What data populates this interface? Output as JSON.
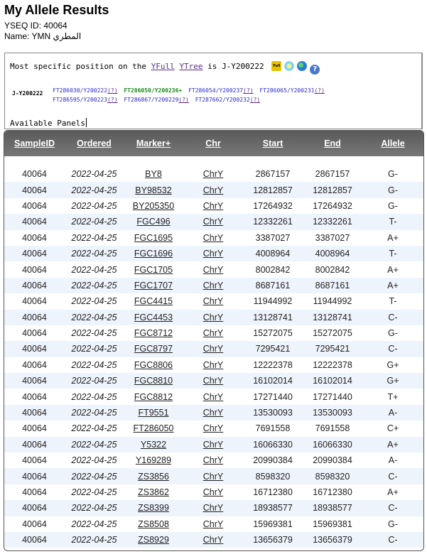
{
  "header": {
    "title": "My Allele Results",
    "yseq_label": "YSEQ ID: 40064",
    "name_label": "Name: YMN المطري"
  },
  "haplogroup": {
    "prefix": "Most specific position on the",
    "yfull_link": "YFull",
    "ytree_link": "YTree",
    "is_text": "is",
    "result": "J-Y200222",
    "full_icon_text": "Full",
    "help_icon_text": "?",
    "label": "J-Y200222",
    "equivalents_line1": [
      {
        "name": "FT286030/Y200222",
        "q": "(?)",
        "highlight": false
      },
      {
        "name": "FT286050/Y200236+",
        "q": "",
        "highlight": true
      },
      {
        "name": "FT286054/Y200237",
        "q": "(?)",
        "highlight": false
      },
      {
        "name": "FT286065/Y200231",
        "q": "(?)",
        "highlight": false
      }
    ],
    "equivalents_line2": [
      {
        "name": "FT286595/Y200223",
        "q": "(?)",
        "highlight": false
      },
      {
        "name": "FT286867/Y200229",
        "q": "(?)",
        "highlight": false
      },
      {
        "name": "FT287662/Y200232",
        "q": "(?)",
        "highlight": false
      }
    ],
    "available_panels": "Available Panels"
  },
  "table": {
    "headers": [
      "SampleID",
      "Ordered",
      "Marker+",
      "Chr",
      "Start",
      "End",
      "Allele"
    ],
    "rows": [
      [
        "40064",
        "2022-04-25",
        "BY8",
        "ChrY",
        "2867157",
        "2867157",
        "G-"
      ],
      [
        "40064",
        "2022-04-25",
        "BY98532",
        "ChrY",
        "12812857",
        "12812857",
        "G-"
      ],
      [
        "40064",
        "2022-04-25",
        "BY205350",
        "ChrY",
        "17264932",
        "17264932",
        "G-"
      ],
      [
        "40064",
        "2022-04-25",
        "FGC496",
        "ChrY",
        "12332261",
        "12332261",
        "T-"
      ],
      [
        "40064",
        "2022-04-25",
        "FGC1695",
        "ChrY",
        "3387027",
        "3387027",
        "A+"
      ],
      [
        "40064",
        "2022-04-25",
        "FGC1696",
        "ChrY",
        "4008964",
        "4008964",
        "T-"
      ],
      [
        "40064",
        "2022-04-25",
        "FGC1705",
        "ChrY",
        "8002842",
        "8002842",
        "A+"
      ],
      [
        "40064",
        "2022-04-25",
        "FGC1707",
        "ChrY",
        "8687161",
        "8687161",
        "A+"
      ],
      [
        "40064",
        "2022-04-25",
        "FGC4415",
        "ChrY",
        "11944992",
        "11944992",
        "T-"
      ],
      [
        "40064",
        "2022-04-25",
        "FGC4453",
        "ChrY",
        "13128741",
        "13128741",
        "C-"
      ],
      [
        "40064",
        "2022-04-25",
        "FGC8712",
        "ChrY",
        "15272075",
        "15272075",
        "G-"
      ],
      [
        "40064",
        "2022-04-25",
        "FGC8797",
        "ChrY",
        "7295421",
        "7295421",
        "C-"
      ],
      [
        "40064",
        "2022-04-25",
        "FGC8806",
        "ChrY",
        "12222378",
        "12222378",
        "G+"
      ],
      [
        "40064",
        "2022-04-25",
        "FGC8810",
        "ChrY",
        "16102014",
        "16102014",
        "G+"
      ],
      [
        "40064",
        "2022-04-25",
        "FGC8812",
        "ChrY",
        "17271440",
        "17271440",
        "T+"
      ],
      [
        "40064",
        "2022-04-25",
        "FT9551",
        "ChrY",
        "13530093",
        "13530093",
        "A-"
      ],
      [
        "40064",
        "2022-04-25",
        "FT286050",
        "ChrY",
        "7691558",
        "7691558",
        "C+"
      ],
      [
        "40064",
        "2022-04-25",
        "Y5322",
        "ChrY",
        "16066330",
        "16066330",
        "A+"
      ],
      [
        "40064",
        "2022-04-25",
        "Y169289",
        "ChrY",
        "20990384",
        "20990384",
        "A-"
      ],
      [
        "40064",
        "2022-04-25",
        "ZS3856",
        "ChrY",
        "8598320",
        "8598320",
        "C-"
      ],
      [
        "40064",
        "2022-04-25",
        "ZS3862",
        "ChrY",
        "16712380",
        "16712380",
        "A+"
      ],
      [
        "40064",
        "2022-04-25",
        "ZS8399",
        "ChrY",
        "18938577",
        "18938577",
        "C-"
      ],
      [
        "40064",
        "2022-04-25",
        "ZS8508",
        "ChrY",
        "15969381",
        "15969381",
        "G-"
      ],
      [
        "40064",
        "2022-04-25",
        "ZS8929",
        "ChrY",
        "13656379",
        "13656379",
        "C-"
      ]
    ]
  },
  "colors": {
    "header_gradient_top": "#5a5a5a",
    "row_stripe": "#eef4fc",
    "link_visited": "#5a2d8a",
    "equiv_blue": "#2a2ad0",
    "equiv_green": "#1a8a1a"
  }
}
